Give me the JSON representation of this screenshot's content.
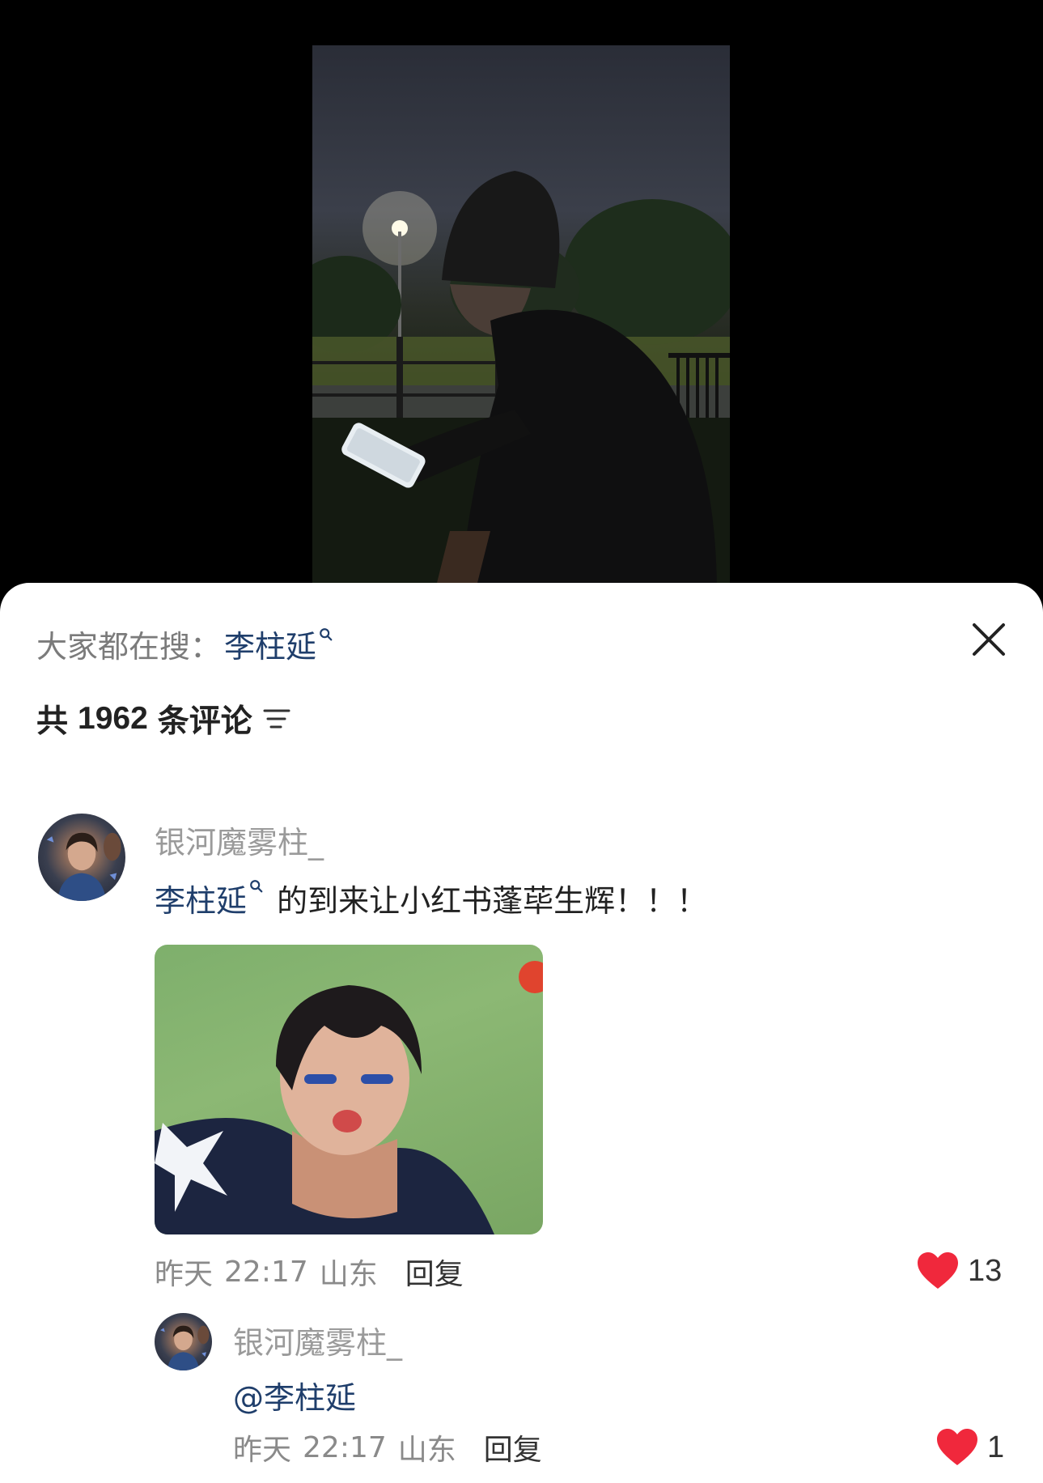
{
  "search_bar": {
    "prefix": "大家都在搜：",
    "keyword": "李柱延"
  },
  "comment_count": {
    "prefix": "共",
    "count": "1962",
    "suffix": "条评论"
  },
  "comments": [
    {
      "author": "银河魔雾柱_",
      "mention": "李柱延",
      "text": " 的到来让小红书蓬荜生辉！！！",
      "date": "昨天",
      "time": "22:17",
      "location": "山东",
      "reply_label": "回复",
      "likes": "13"
    }
  ],
  "replies": [
    {
      "author": "银河魔雾柱_",
      "text": "@李柱延",
      "date": "昨天",
      "time": "22:17",
      "location": "山东",
      "reply_label": "回复",
      "likes": "1"
    }
  ],
  "colors": {
    "accent_link": "#1f3e6b",
    "like_heart": "#f0283c",
    "muted": "#8a8a8a"
  },
  "icons": [
    "close-icon",
    "sort-icon",
    "search-hint-icon",
    "heart-icon"
  ]
}
